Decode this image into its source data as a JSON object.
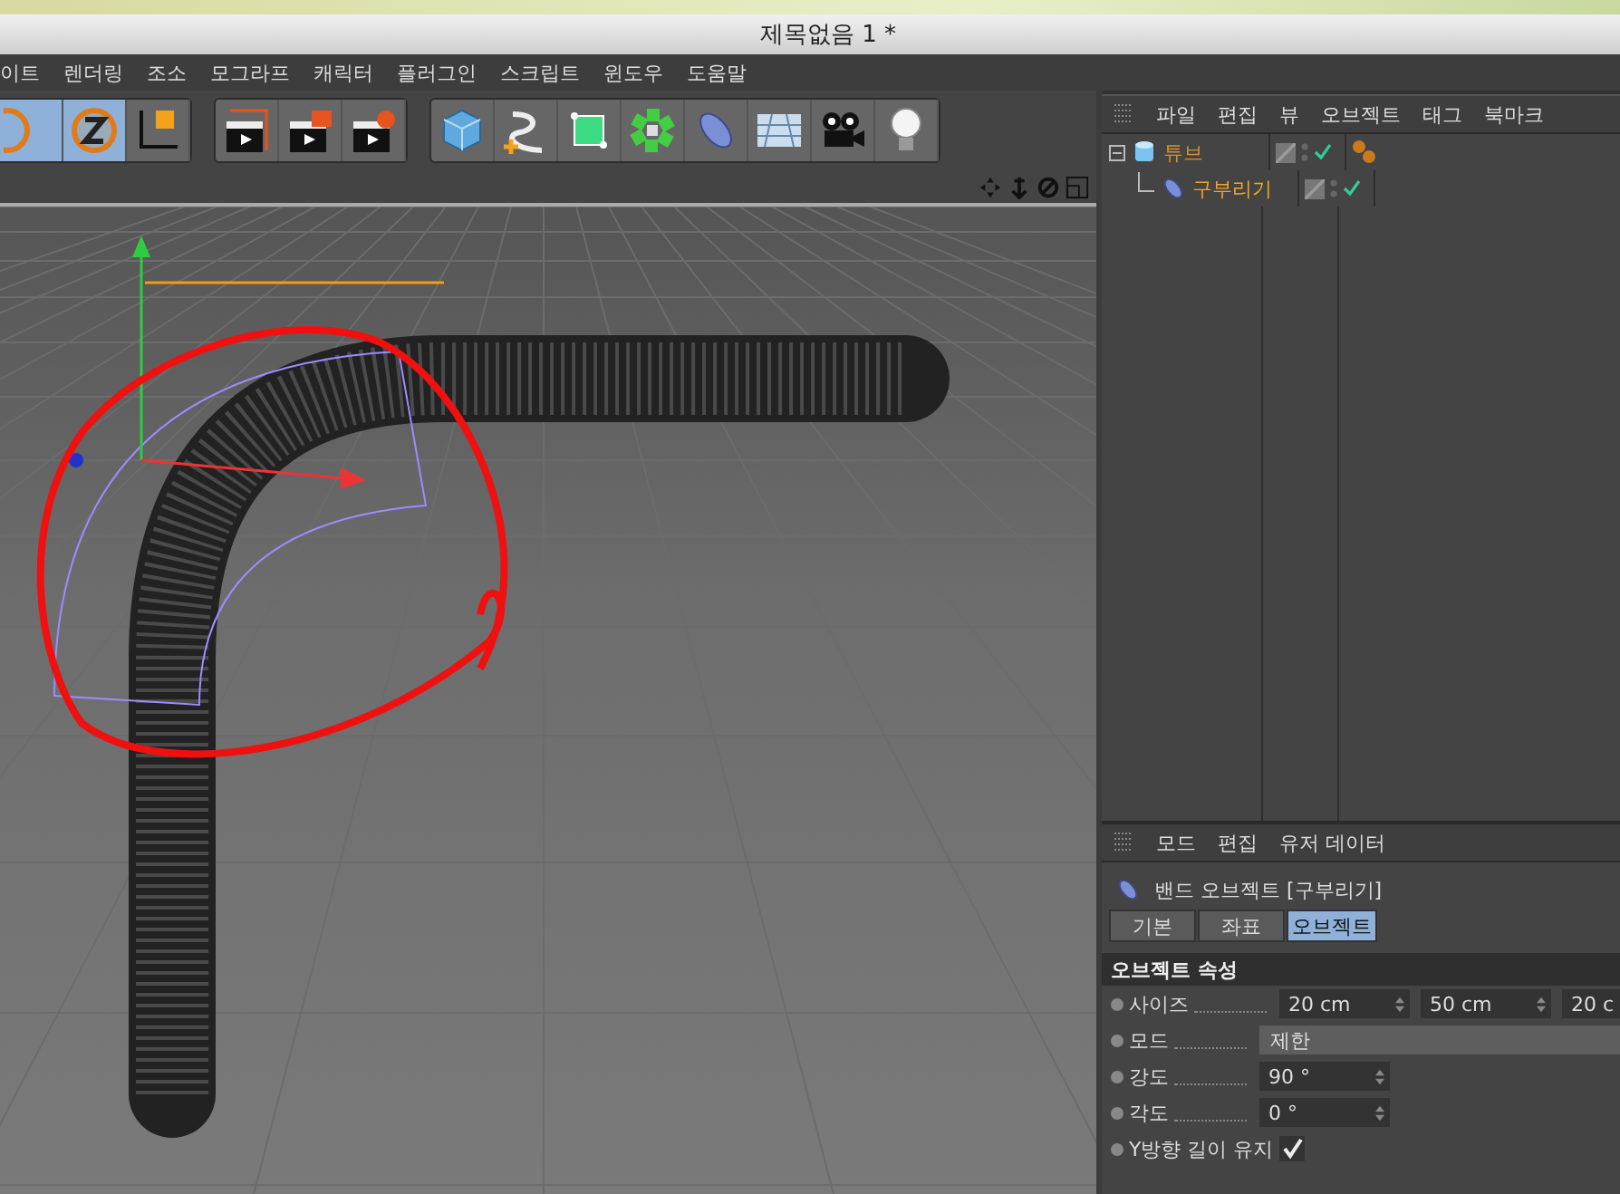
{
  "window": {
    "title": "제목없음 1 *"
  },
  "menu": [
    "이트",
    "렌더링",
    "조소",
    "모그라프",
    "캐릭터",
    "플러그인",
    "스크립트",
    "윈도우",
    "도움말"
  ],
  "object_manager": {
    "menu": [
      "파일",
      "편집",
      "뷰",
      "오브젝트",
      "태그",
      "북마크"
    ],
    "tree": [
      {
        "name": "튜브",
        "expanded": true,
        "enabled": true,
        "children": [
          {
            "name": "구부리기",
            "enabled": true
          }
        ]
      }
    ]
  },
  "attribute_manager": {
    "menu": [
      "모드",
      "편집",
      "유저 데이터"
    ],
    "object_title": "밴드 오브젝트 [구부리기]",
    "tabs": [
      {
        "label": "기본",
        "selected": false
      },
      {
        "label": "좌표",
        "selected": false
      },
      {
        "label": "오브젝트",
        "selected": true
      }
    ],
    "section": "오브젝트 속성",
    "properties": [
      {
        "kind": "vector",
        "label": "사이즈",
        "values": [
          "20 cm",
          "50 cm",
          "20 c"
        ]
      },
      {
        "kind": "dropdown",
        "label": "모드",
        "value": "제한"
      },
      {
        "kind": "number",
        "label": "강도",
        "value": "90 °"
      },
      {
        "kind": "number",
        "label": "각도",
        "value": "0 °"
      },
      {
        "kind": "checkbox",
        "label": "Y방향 길이 유지",
        "checked": true
      }
    ]
  }
}
